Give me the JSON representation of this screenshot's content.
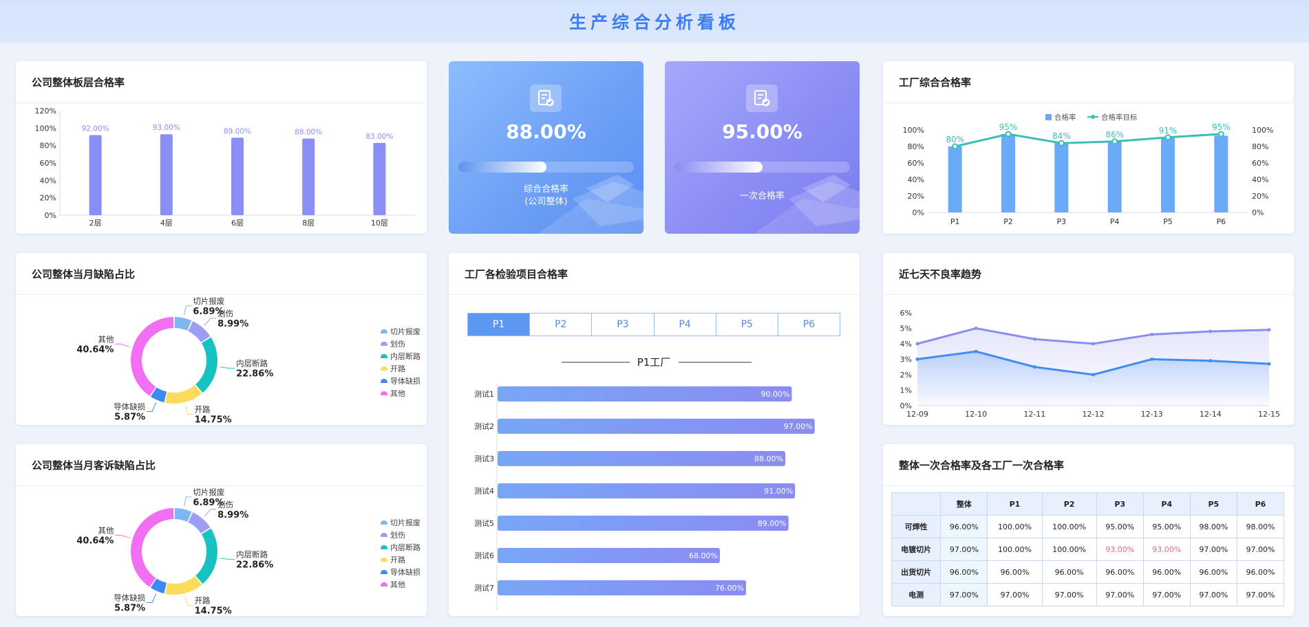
{
  "page": {
    "title": "生产综合分析看板"
  },
  "panels": {
    "floor_rate": {
      "title": "公司整体板层合格率"
    },
    "kpi1": {
      "value": "88.00%",
      "label_line1": "综合合格率",
      "label_line2": "(公司整体)",
      "progress": 0.5
    },
    "kpi2": {
      "value": "95.00%",
      "label": "一次合格率",
      "progress": 0.5
    },
    "factory_rate": {
      "title": "工厂综合合格率"
    },
    "defect_share": {
      "title": "公司整体当月缺陷占比"
    },
    "inspection": {
      "title": "工厂各检验项目合格率",
      "tabs": [
        "P1",
        "P2",
        "P3",
        "P4",
        "P5",
        "P6"
      ],
      "active_tab": 0,
      "subtitle": "P1工厂"
    },
    "trend": {
      "title": "近七天不良率趋势"
    },
    "complaint_share": {
      "title": "公司整体当月客诉缺陷占比"
    },
    "first_pass": {
      "title": "整体一次合格率及各工厂一次合格率",
      "headers": [
        "",
        "整体",
        "P1",
        "P2",
        "P3",
        "P4",
        "P5",
        "P6"
      ],
      "rows": [
        [
          "可焊性",
          "96.00%",
          "100.00%",
          "100.00%",
          "95.00%",
          "95.00%",
          "98.00%",
          "98.00%"
        ],
        [
          "电镀切片",
          "97.00%",
          "100.00%",
          "100.00%",
          "93.00%",
          "93.00%",
          "97.00%",
          "97.00%"
        ],
        [
          "出货切片",
          "96.00%",
          "96.00%",
          "96.00%",
          "96.00%",
          "96.00%",
          "96.00%",
          "96.00%"
        ],
        [
          "电测",
          "97.00%",
          "97.00%",
          "97.00%",
          "97.00%",
          "97.00%",
          "97.00%",
          "97.00%"
        ]
      ],
      "highlight_color": "#f0677f",
      "highlight_cells": [
        [
          1,
          4
        ],
        [
          1,
          5
        ]
      ]
    }
  },
  "chart_data": [
    {
      "id": "floor-rate",
      "type": "bar",
      "categories": [
        "2层",
        "4层",
        "6层",
        "8层",
        "10层"
      ],
      "values": [
        92,
        93,
        89,
        88,
        83
      ],
      "data_labels": [
        "92.00%",
        "93.00%",
        "89.00%",
        "88.00%",
        "83.00%"
      ],
      "yticks": [
        "0%",
        "20%",
        "40%",
        "60%",
        "80%",
        "100%",
        "120%"
      ],
      "ylim": [
        0,
        120
      ],
      "color": "#8b8ff5"
    },
    {
      "id": "factory-rate",
      "type": "bar",
      "categories": [
        "P1",
        "P2",
        "P3",
        "P4",
        "P5",
        "P6"
      ],
      "legend": [
        "合格率",
        "合格率目标"
      ],
      "series": [
        {
          "name": "合格率",
          "type": "bar",
          "values": [
            80,
            95,
            84,
            86,
            91,
            93
          ],
          "color": "#6aaaf7"
        },
        {
          "name": "合格率目标",
          "type": "line",
          "values": [
            80,
            95,
            84,
            86,
            91,
            95
          ],
          "data_labels": [
            "80%",
            "95%",
            "84%",
            "86%",
            "91%",
            "95%"
          ],
          "color": "#3bbdb8"
        }
      ],
      "yticks": [
        "0%",
        "20%",
        "40%",
        "60%",
        "80%",
        "100%"
      ],
      "ylim": [
        0,
        100
      ]
    },
    {
      "id": "defect-share",
      "type": "pie",
      "slices": [
        {
          "name": "切片报废",
          "value": 6.89,
          "label": "6.89%",
          "color": "#7fb7f0"
        },
        {
          "name": "划伤",
          "value": 8.99,
          "label": "8.99%",
          "color": "#9c9df5"
        },
        {
          "name": "内层断路",
          "value": 22.86,
          "label": "22.86%",
          "color": "#19c2c2"
        },
        {
          "name": "开路",
          "value": 14.75,
          "label": "14.75%",
          "color": "#fddc5c"
        },
        {
          "name": "导体缺损",
          "value": 5.87,
          "label": "5.87%",
          "color": "#3d8af0"
        },
        {
          "name": "其他",
          "value": 40.64,
          "label": "40.64%",
          "color": "#f26ef2"
        }
      ]
    },
    {
      "id": "inspection",
      "type": "bar",
      "orientation": "horizontal",
      "categories": [
        "测试1",
        "测试2",
        "测试3",
        "测试4",
        "测试5",
        "测试6",
        "测试7"
      ],
      "values": [
        90,
        97,
        88,
        91,
        89,
        68,
        76
      ],
      "data_labels": [
        "90.00%",
        "97.00%",
        "88.00%",
        "91.00%",
        "89.00%",
        "68.00%",
        "76.00%"
      ],
      "xlim": [
        0,
        100
      ]
    },
    {
      "id": "trend",
      "type": "area",
      "x": [
        "12-09",
        "12-10",
        "12-11",
        "12-12",
        "12-13",
        "12-14",
        "12-15"
      ],
      "series": [
        {
          "values": [
            4.0,
            5.0,
            4.3,
            4.0,
            4.6,
            4.8,
            4.9
          ],
          "color": "#8c8df2"
        },
        {
          "values": [
            3.0,
            3.5,
            2.5,
            2.0,
            3.0,
            2.9,
            2.7
          ],
          "color": "#3f8cf2"
        }
      ],
      "yticks": [
        "0%",
        "1%",
        "2%",
        "3%",
        "4%",
        "5%",
        "6%"
      ],
      "ylim": [
        0,
        6
      ]
    },
    {
      "id": "complaint-share",
      "type": "pie",
      "slices": [
        {
          "name": "切片报废",
          "value": 6.89,
          "label": "6.89%",
          "color": "#7fb7f0"
        },
        {
          "name": "划伤",
          "value": 8.99,
          "label": "8.99%",
          "color": "#9c9df5"
        },
        {
          "name": "内层断路",
          "value": 22.86,
          "label": "22.86%",
          "color": "#19c2c2"
        },
        {
          "name": "开路",
          "value": 14.75,
          "label": "14.75%",
          "color": "#fddc5c"
        },
        {
          "name": "导体缺损",
          "value": 5.87,
          "label": "5.87%",
          "color": "#3d8af0"
        },
        {
          "name": "其他",
          "value": 40.64,
          "label": "40.64%",
          "color": "#f26ef2"
        }
      ]
    }
  ]
}
